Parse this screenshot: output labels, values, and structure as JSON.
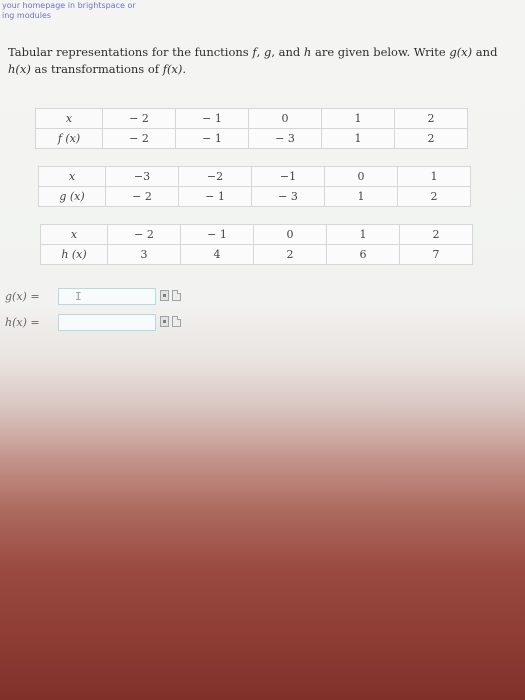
{
  "header": {
    "line1": "your homepage in brightspace or",
    "line2": "ing modules"
  },
  "problem": {
    "intro": "Tabular representations for the functions ",
    "f": "f",
    "comma": ", ",
    "g": "g",
    "and": ", and ",
    "h": "h",
    "mid": " are given below. Write ",
    "gx": "g(x)",
    "and2": " and ",
    "hx": "h(x)",
    "as": " as transformations of ",
    "fx": "f(x)",
    "end": "."
  },
  "tables": [
    {
      "row1": {
        "label": "x",
        "values": [
          "− 2",
          "− 1",
          "0",
          "1",
          "2"
        ]
      },
      "row2": {
        "label": "f (x)",
        "values": [
          "− 2",
          "− 1",
          "− 3",
          "1",
          "2"
        ]
      }
    },
    {
      "row1": {
        "label": "x",
        "values": [
          "−3",
          "−2",
          "−1",
          "0",
          "1"
        ]
      },
      "row2": {
        "label": "g (x)",
        "values": [
          "− 2",
          "− 1",
          "− 3",
          "1",
          "2"
        ]
      }
    },
    {
      "row1": {
        "label": "x",
        "values": [
          "− 2",
          "− 1",
          "0",
          "1",
          "2"
        ]
      },
      "row2": {
        "label": "h (x)",
        "values": [
          "3",
          "4",
          "2",
          "6",
          "7"
        ]
      }
    }
  ],
  "answers": {
    "g_label": "g(x) =",
    "h_label": "h(x) =",
    "g_value": "",
    "h_value": "",
    "cursor": "I"
  }
}
